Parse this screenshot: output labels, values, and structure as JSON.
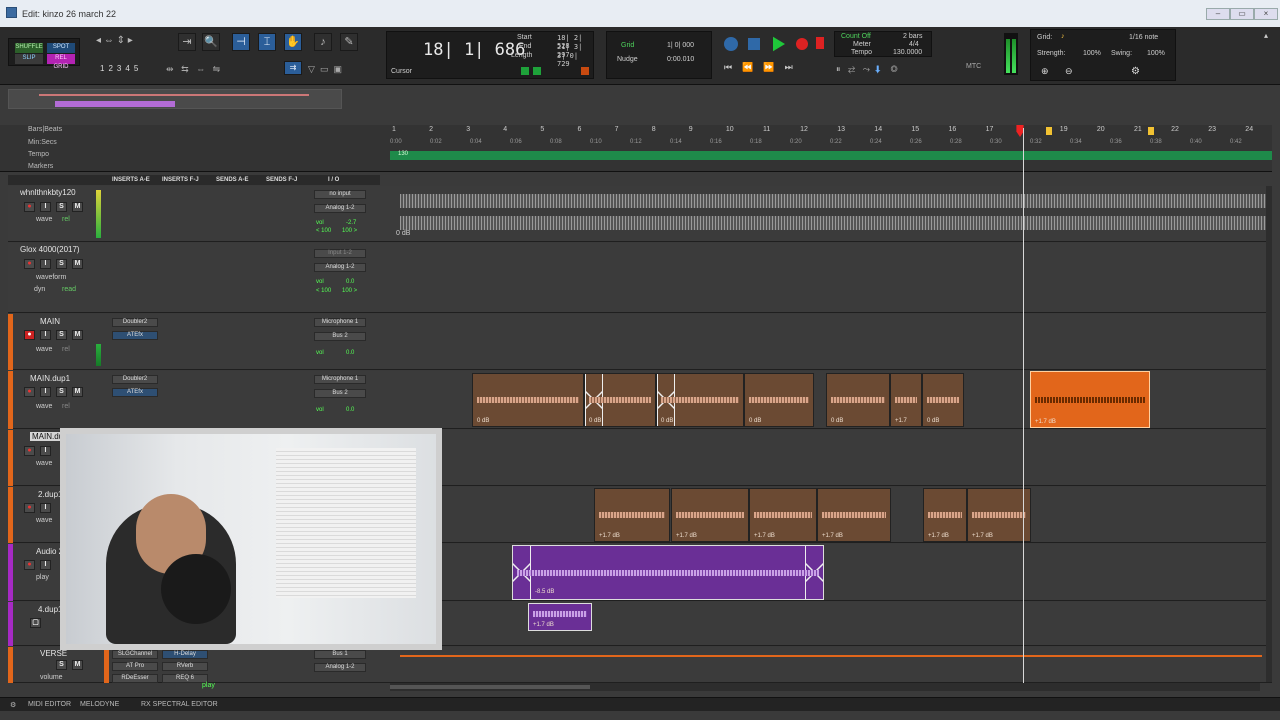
{
  "window": {
    "title": "Edit: kinzo 26 march 22"
  },
  "modes": {
    "shuffle": "SHUFFLE",
    "spot": "SPOT",
    "slip": "SLIP",
    "relgrid": "REL GRID"
  },
  "zoom_presets": [
    "1",
    "2",
    "3",
    "4",
    "5"
  ],
  "counter": {
    "main": "18| 1| 686",
    "start_label": "Start",
    "end_label": "End",
    "length_label": "Length",
    "start": "18| 2| 528",
    "end": "21| 3| 297",
    "length": "3| 0| 729",
    "cursor_label": "Cursor"
  },
  "grid_nudge": {
    "grid_label": "Grid",
    "grid_value": "1| 0| 000",
    "nudge_label": "Nudge",
    "nudge_value": "0:00.010"
  },
  "transport": {
    "countoff": "Count Off",
    "meter": "Meter",
    "tempo": "Tempo",
    "countoff_val": "2 bars",
    "meter_val": "4/4",
    "tempo_val": "130.0000",
    "mtc": "MTC"
  },
  "grid_panel": {
    "grid_label": "Grid:",
    "grid_value": "1/16 note",
    "strength_label": "Strength:",
    "strength_value": "100%",
    "swing_label": "Swing:",
    "swing_value": "100%"
  },
  "rulers": {
    "bars": "Bars|Beats",
    "minsecs": "Min:Secs",
    "tempo": "Tempo",
    "markers": "Markers",
    "tempo_value": "130"
  },
  "bar_ticks": [
    "1",
    "2",
    "3",
    "4",
    "5",
    "6",
    "7",
    "8",
    "9",
    "10",
    "11",
    "12",
    "13",
    "14",
    "15",
    "16",
    "17",
    "19",
    "20",
    "21",
    "22",
    "23",
    "24"
  ],
  "time_ticks": [
    "0:00",
    "0:02",
    "0:04",
    "0:06",
    "0:08",
    "0:10",
    "0:12",
    "0:14",
    "0:16",
    "0:18",
    "0:20",
    "0:22",
    "0:24",
    "0:26",
    "0:28",
    "0:30",
    "0:32",
    "0:34",
    "0:36",
    "0:38",
    "0:40",
    "0:42"
  ],
  "columns": {
    "inserts_ae": "INSERTS A-E",
    "inserts_fj": "INSERTS F-J",
    "sends_ae": "SENDS A-E",
    "sends_fj": "SENDS F-J",
    "io": "I / O"
  },
  "tracks": [
    {
      "name": "whnlthnkbty120",
      "view": "wave",
      "mode": "rel",
      "input": "no input",
      "output": "Analog 1-2",
      "vol": "-2.7",
      "pan_l": "< 100",
      "pan_r": "100 >",
      "inserts": []
    },
    {
      "name": "Glox 4000(2017)",
      "view": "waveform",
      "mode": "read",
      "dyn": "dyn",
      "input": "Input 1-2",
      "output": "Analog 1-2",
      "vol": "0.0",
      "pan_l": "< 100",
      "pan_r": "100 >",
      "inserts": []
    },
    {
      "name": "MAIN",
      "view": "wave",
      "mode": "rel",
      "input": "Microphone 1",
      "output": "Bus 2",
      "vol": "0.0",
      "inserts": [
        "Doubler2",
        "ATEfx"
      ]
    },
    {
      "name": "MAIN.dup1",
      "view": "wave",
      "mode": "rel",
      "input": "Microphone 1",
      "output": "Bus 2",
      "vol": "0.0",
      "inserts": [
        "Doubler2",
        "ATEfx"
      ]
    },
    {
      "name": "MAIN.du",
      "view": "wave"
    },
    {
      "name": "2.dup1",
      "view": "wave"
    },
    {
      "name": "Audio 2",
      "view": "play"
    },
    {
      "name": "4.dup1",
      "view": ""
    },
    {
      "name": "VERSE",
      "view": "volume",
      "input": "Bus 1",
      "output": "Analog 1-2",
      "inserts": [
        "SLGChannel",
        "AT Pro",
        "RDeEsser"
      ],
      "inserts2": [
        "H-Delay",
        "RVerb",
        "REQ 6"
      ],
      "automation": "play"
    }
  ],
  "clips": {
    "ref_gain": "0 dB",
    "main_dup1": [
      "0 dB",
      "0 dB",
      "0 dB",
      "0 dB",
      "0 dB",
      "+1.7",
      "0 dB",
      "+1.7 dB"
    ],
    "dup2": [
      "+1.7 dB",
      "+1.7 dB",
      "+1.7 dB",
      "+1.7 dB",
      "+1.7 dB",
      "+1.7 dB"
    ],
    "audio2": "-8.5 dB",
    "dup4": "+1.7 dB"
  },
  "bottom": {
    "midi_editor": "MIDI EDITOR",
    "melodyne": "MELODYNE",
    "rx": "RX SPECTRAL EDITOR"
  },
  "colors": {
    "accent": "#2b5e99",
    "record": "#dd2222",
    "play": "#1fc83a",
    "clip_orange": "#e2661b",
    "clip_brown": "#6b4a33",
    "clip_purple": "#6a2f96",
    "tempo_green": "#1e8a4a"
  }
}
